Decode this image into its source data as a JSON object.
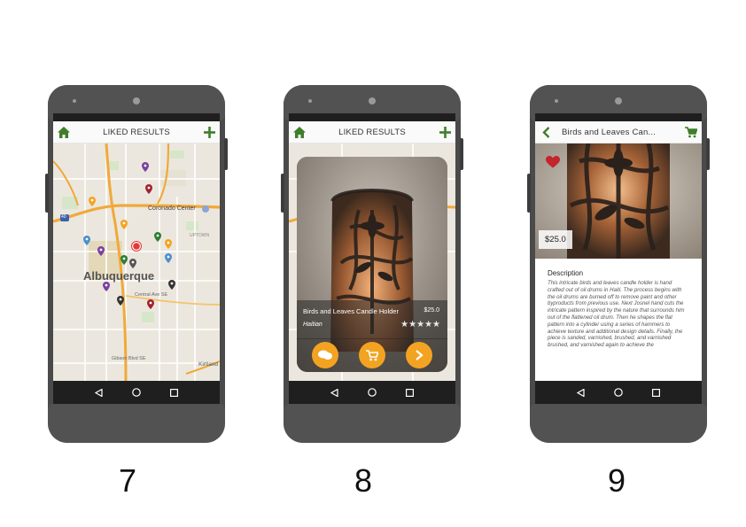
{
  "screens": [
    {
      "step": "7",
      "title": "LIKED RESULTS",
      "map": {
        "city_label": "Albuquerque",
        "poi_label": "Coronado Center",
        "district_label": "UPTOWN",
        "street_1": "Central Ave SE",
        "street_2": "Gibson Blvd SE",
        "place_right": "Kirtland",
        "highway_shield": "40",
        "pin_colors": [
          "#7b3fa0",
          "#a3202f",
          "#f3a322",
          "#4a8fd0",
          "#2f7d32",
          "#333333"
        ]
      }
    },
    {
      "step": "8",
      "title": "LIKED RESULTS",
      "card": {
        "name": "Birds and Leaves Candle Holder",
        "price": "$25.0",
        "origin": "Haitian",
        "rating": 5,
        "stars": "★★★★★"
      }
    },
    {
      "step": "9",
      "title": "Birds and Leaves Can...",
      "price": "$25.0",
      "description_heading": "Description",
      "description": "This intricate birds and leaves candle holder is hand crafted out of oil drums in Haiti. The process begins with the oil drums are burned off to remove paint and other byproducts from previous use. Next Josnel hand cuts the intricate pattern inspired by the nature that surrounds him out of the flattened oil drum. Then he shapes the flat pattern into a cylinder using a series of hammers to achieve texture and additional design details. Finally, the piece is sanded, varnished, brushed, and varnished brushed, and varnished again to achieve the"
    }
  ],
  "colors": {
    "accent_green": "#3f7e2a",
    "accent_orange": "#f3a322",
    "heart_red": "#c4242b"
  }
}
